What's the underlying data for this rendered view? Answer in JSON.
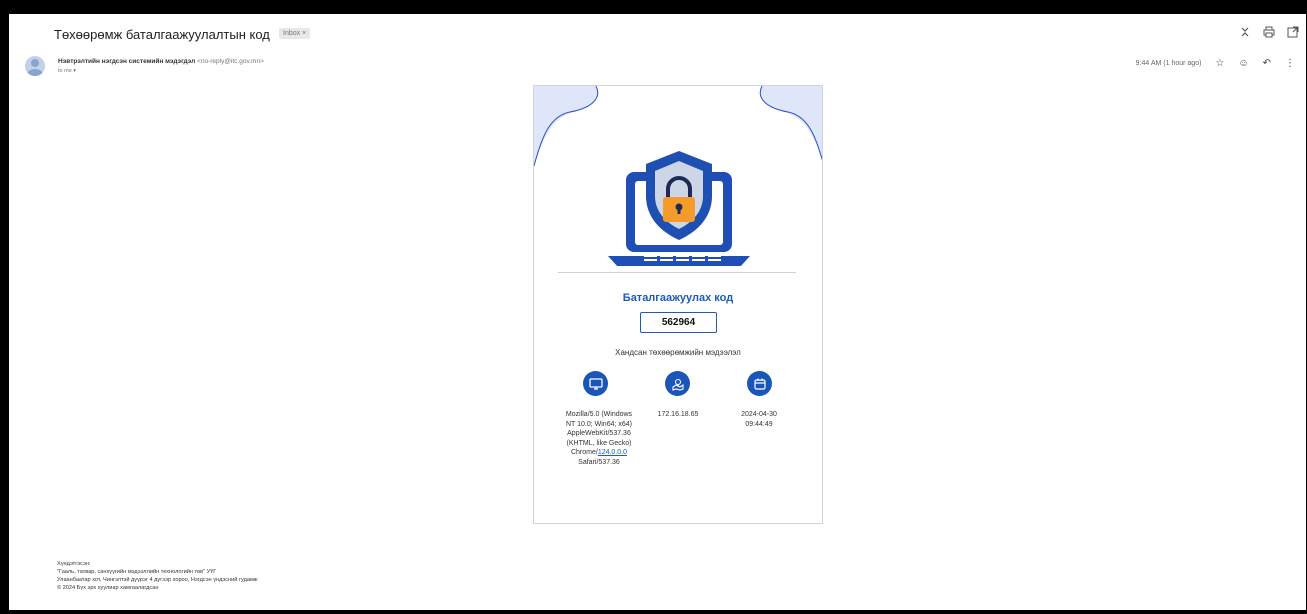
{
  "email": {
    "subject": "Төхөөрөмж баталгаажуулалтын код",
    "inbox_badge": "Inbox ×",
    "sender_name": "Нэвтрэлтийн нэгдсэн системийн мэдэгдэл",
    "sender_email": "<no-reply@itc.gov.mn>",
    "to_line": "to me ▾",
    "timestamp": "9:44 AM (1 hour ago)"
  },
  "top_icons": [
    "collapse-icon",
    "print-icon",
    "open-in-new-icon"
  ],
  "sender_icons": [
    "star-icon",
    "emoji-icon",
    "reply-icon",
    "more-vert-icon"
  ],
  "card": {
    "code_title": "Баталгаажуулах код",
    "code": "562964",
    "device_title": "Хандсан төхөөрөмжийн мэдээлэл",
    "accent_color": "#1a56b8",
    "user_agent_prefix": "Mozilla/5.0 (Windows NT 10.0; Win64; x64) AppleWebKit/537.36 (KHTML, like Gecko) Chrome/",
    "user_agent_version": "124.0.0.0",
    "user_agent_suffix": " Safari/537.36",
    "ip": "172.16.18.65",
    "datetime": "2024-04-30 09:44:49"
  },
  "footer": {
    "line1": "Хүндэтгэсэн:",
    "line2": "\"Гааль, татвар, санхүүгийн мэдээллийн технологийн төв\" УҮГ",
    "line3": "Улаанбаатар хот, Чингэлтэй дүүрэг 4 дүгээр хороо, Нэгдсэн үндэсний гудамж",
    "line4": "© 2024 Бүх эрх хуулиар хамгаалагдсан"
  }
}
